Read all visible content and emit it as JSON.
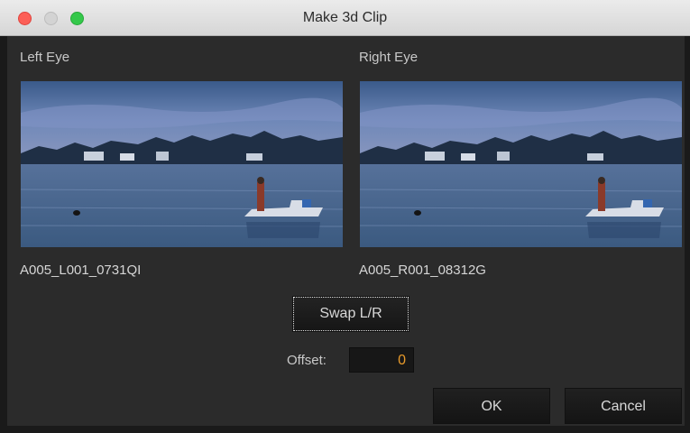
{
  "window": {
    "title": "Make 3d Clip",
    "traffic_lights": [
      "close",
      "minimize",
      "zoom"
    ]
  },
  "left": {
    "heading": "Left Eye",
    "clip_name": "A005_L001_0731QI"
  },
  "right": {
    "heading": "Right Eye",
    "clip_name": "A005_R001_08312G"
  },
  "swap_button": "Swap L/R",
  "offset": {
    "label": "Offset:",
    "value": "0"
  },
  "buttons": {
    "ok": "OK",
    "cancel": "Cancel"
  },
  "colors": {
    "offset_value": "#e89a2a",
    "close": "#fc5f57",
    "zoom": "#34c84a"
  }
}
